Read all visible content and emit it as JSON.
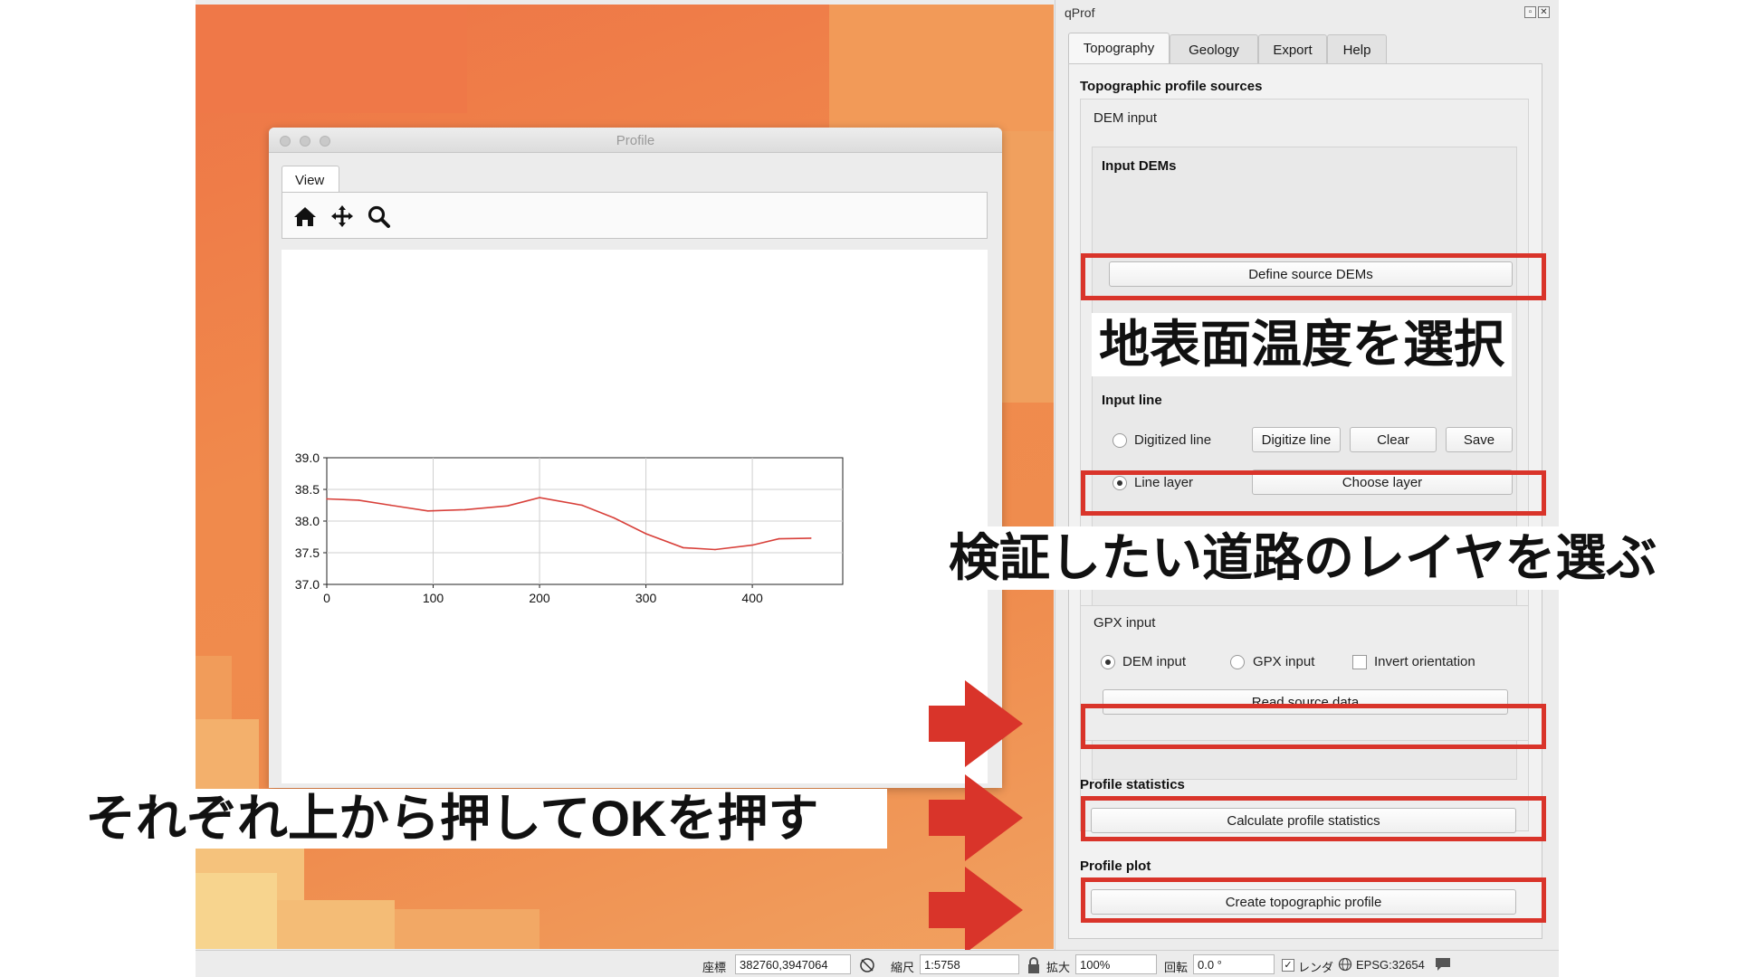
{
  "profile_window": {
    "title": "Profile",
    "tab_view": "View",
    "toolbar_icons": [
      "home-icon",
      "pan-icon",
      "zoom-icon"
    ]
  },
  "chart_data": {
    "type": "line",
    "x": [
      0,
      30,
      60,
      95,
      130,
      170,
      200,
      240,
      270,
      300,
      335,
      365,
      400,
      425,
      455
    ],
    "series": [
      {
        "values": [
          38.35,
          38.33,
          38.25,
          38.16,
          38.18,
          38.24,
          38.37,
          38.25,
          38.05,
          37.8,
          37.58,
          37.55,
          37.62,
          37.72,
          37.73
        ],
        "color": "#d8403a"
      }
    ],
    "xticks": [
      "0",
      "100",
      "200",
      "300",
      "400"
    ],
    "yticks": [
      "37.0",
      "37.5",
      "38.0",
      "38.5",
      "39.0"
    ],
    "xlim": [
      0,
      485
    ],
    "ylim": [
      37.0,
      39.0
    ],
    "grid": true
  },
  "qprof": {
    "title": "qProf",
    "tabs": [
      "Topography",
      "Geology",
      "Export",
      "Help"
    ],
    "section_sources": "Topographic profile sources",
    "dem_group": "DEM input",
    "input_dems": "Input DEMs",
    "define_dems_button": "Define source DEMs",
    "input_line": "Input line",
    "digitized_line": "Digitized line",
    "digitize_line_button": "Digitize line",
    "clear_button": "Clear",
    "save_button": "Save",
    "line_layer": "Line layer",
    "choose_layer_button": "Choose layer",
    "gpx_group": "GPX input",
    "dem_input_radio": "DEM input",
    "gpx_input_radio": "GPX input",
    "invert_orientation": "Invert orientation",
    "read_source_button": "Read source data",
    "section_stats": "Profile statistics",
    "calc_stats_button": "Calculate profile statistics",
    "section_plot": "Profile plot",
    "create_profile_button": "Create topographic profile"
  },
  "annotations": {
    "caption_dem": "地表面温度を選択",
    "caption_layer": "検証したい道路のレイヤを選ぶ",
    "caption_buttons": "それぞれ上から押してOKを押す",
    "accent_color": "#d9342a"
  },
  "statusbar": {
    "coord_label": "座標",
    "coord_value": "382760,3947064",
    "scale_label": "縮尺",
    "scale_value": "1:5758",
    "magnify_label": "拡大",
    "magnify_value": "100%",
    "rotation_label": "回転",
    "rotation_value": "0.0 °",
    "render_label": "レンダ",
    "crs_value": "EPSG:32654"
  }
}
